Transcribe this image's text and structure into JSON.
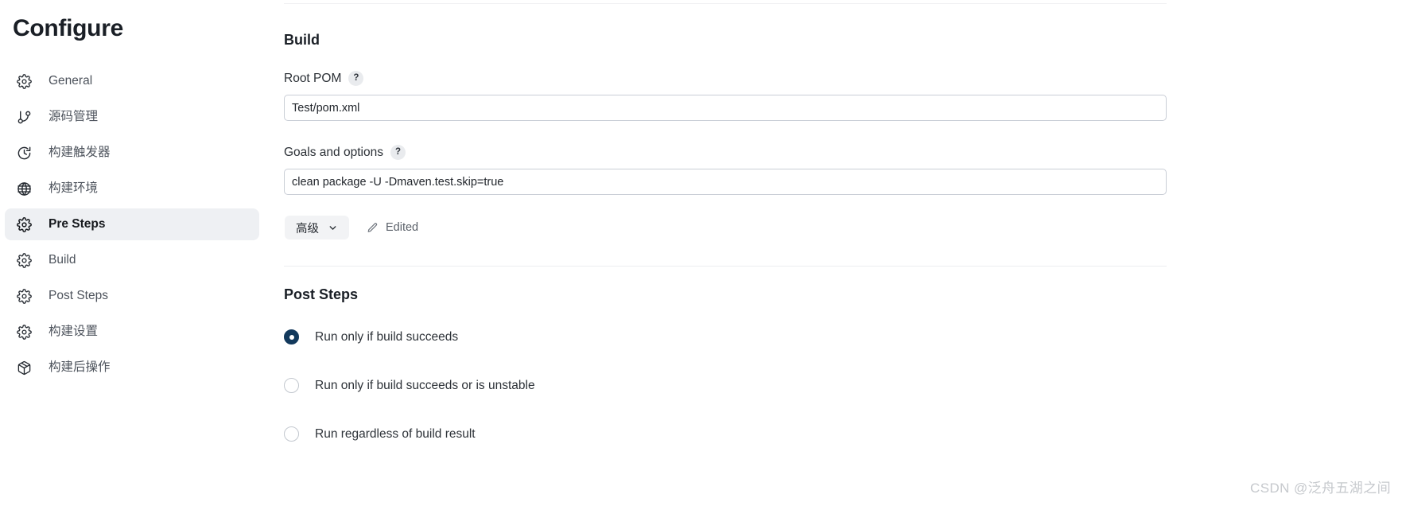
{
  "sidebar": {
    "title": "Configure",
    "items": [
      {
        "label": "General",
        "icon": "gear-icon",
        "active": false
      },
      {
        "label": "源码管理",
        "icon": "git-branch-icon",
        "active": false
      },
      {
        "label": "构建触发器",
        "icon": "clock-icon",
        "active": false
      },
      {
        "label": "构建环境",
        "icon": "globe-icon",
        "active": false
      },
      {
        "label": "Pre Steps",
        "icon": "gear-icon",
        "active": true
      },
      {
        "label": "Build",
        "icon": "gear-icon",
        "active": false
      },
      {
        "label": "Post Steps",
        "icon": "gear-icon",
        "active": false
      },
      {
        "label": "构建设置",
        "icon": "gear-icon",
        "active": false
      },
      {
        "label": "构建后操作",
        "icon": "package-icon",
        "active": false
      }
    ]
  },
  "main": {
    "build": {
      "heading": "Build",
      "root_pom": {
        "label": "Root POM",
        "help": "?",
        "value": "Test/pom.xml",
        "placeholder": ""
      },
      "goals": {
        "label": "Goals and options",
        "help": "?",
        "value": "clean package -U -Dmaven.test.skip=true",
        "placeholder": ""
      },
      "advanced_button": {
        "label": "高级",
        "chevron": "chevron-down-icon"
      },
      "edited_chip": {
        "label": "Edited",
        "icon": "pencil-icon"
      }
    },
    "post_steps": {
      "heading": "Post Steps",
      "options": [
        {
          "label": "Run only if build succeeds",
          "selected": true
        },
        {
          "label": "Run only if build succeeds or is unstable",
          "selected": false
        },
        {
          "label": "Run regardless of build result",
          "selected": false
        }
      ]
    }
  },
  "watermark": {
    "text": "CSDN @泛舟五湖之间"
  },
  "colors": {
    "accent": "#12395c",
    "active_nav_bg": "#eef0f3",
    "input_border": "#c9ced6",
    "help_badge_bg": "#e9ebee"
  }
}
